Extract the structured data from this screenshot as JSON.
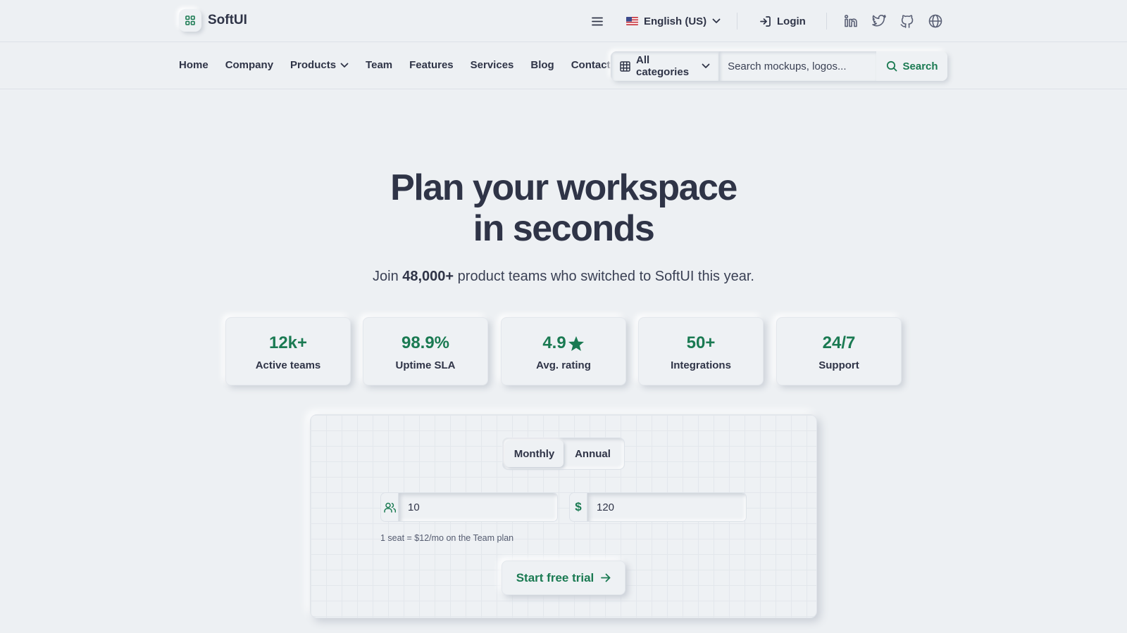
{
  "brand": {
    "name": "SoftUI",
    "logo_icon": "grid-icon"
  },
  "header": {
    "language": "English (US)",
    "login_label": "Login",
    "social": [
      "linkedin-icon",
      "twitter-icon",
      "github-icon",
      "globe-icon"
    ]
  },
  "nav": {
    "items": [
      {
        "label": "Home"
      },
      {
        "label": "Company"
      },
      {
        "label": "Products",
        "has_dropdown": true
      },
      {
        "label": "Team"
      },
      {
        "label": "Features"
      },
      {
        "label": "Services"
      },
      {
        "label": "Blog"
      },
      {
        "label": "Contact"
      }
    ]
  },
  "search": {
    "category": "All categories",
    "placeholder": "Search mockups, logos...",
    "button_label": "Search"
  },
  "hero": {
    "title_line1": "Plan your workspace",
    "title_line2": "in seconds",
    "sub_prefix": "Join ",
    "sub_highlight": "48,000+",
    "sub_suffix": " product teams who switched to SoftUI this year."
  },
  "stats": [
    {
      "value": "12k+",
      "label": "Active teams"
    },
    {
      "value": "98.9%",
      "label": "Uptime SLA"
    },
    {
      "value": "4.9",
      "label": "Avg. rating",
      "icon": "star-icon"
    },
    {
      "value": "50+",
      "label": "Integrations"
    },
    {
      "value": "24/7",
      "label": "Support"
    }
  ],
  "pricing": {
    "toggle": [
      "Monthly",
      "Annual"
    ],
    "active_toggle": "Monthly",
    "seats_value": "10",
    "amount_value": "120",
    "currency_symbol": "$",
    "hint": "1 seat = $12/mo on the Team plan",
    "cta_label": "Start free trial"
  },
  "colors": {
    "accent": "#1a7a52",
    "text": "#2f3447",
    "background": "#edf0f3"
  }
}
